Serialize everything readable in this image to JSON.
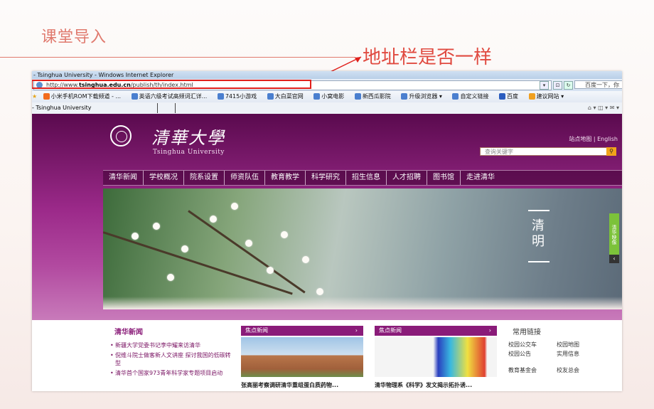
{
  "slide": {
    "title": "课堂导入",
    "callout": "地址栏是否一样",
    "colors": {
      "accent": "#e07a6e",
      "callout": "#e04a40",
      "highlight": "#e0201c"
    }
  },
  "browser": {
    "window_title": "- Tsinghua University - Windows Internet Explorer",
    "address_prefix": "http://www.",
    "address_host": "tsinghua.edu.cn",
    "address_path": "/publish/th/index.html",
    "search_box_text": "百度一下，你",
    "favorites": [
      {
        "label": "小米手机ROM下载频道 - ...",
        "icon": "mi-icon"
      },
      {
        "label": "英语六级考试高频词汇详...",
        "icon": "ie-icon"
      },
      {
        "label": "7415小游戏",
        "icon": "ie-icon"
      },
      {
        "label": "大白菜官网",
        "icon": "ie-icon"
      },
      {
        "label": "小窝电影",
        "icon": "ie-icon"
      },
      {
        "label": "新西瓜影院",
        "icon": "ie-icon"
      },
      {
        "label": "升级浏览器 ▾",
        "icon": "ie-icon"
      },
      {
        "label": "自定义链接",
        "icon": "ie-icon"
      },
      {
        "label": "百度",
        "icon": "baidu-icon"
      },
      {
        "label": "建议网站 ▾",
        "icon": "suggest-icon"
      }
    ],
    "tab_title": "- Tsinghua University"
  },
  "site": {
    "logo_cn": "清華大學",
    "logo_en": "Tsinghua University",
    "top_links": "站点地图 | English",
    "search_placeholder": "查询关键字",
    "nav": [
      "清华新闻",
      "学校概况",
      "院系设置",
      "师资队伍",
      "教育教学",
      "科学研究",
      "招生信息",
      "人才招聘",
      "图书馆",
      "走进清华"
    ],
    "banner_text": "清明",
    "side_tab": "清华映像",
    "news_title": "清华新闻",
    "news": [
      "新疆大学党委书记李中耀来访清华",
      "倪维斗院士做客新人文讲座 探讨我国的低碳转型",
      "清华首个国家973青年科学家专题项目启动"
    ],
    "focus1": {
      "head": "焦点新闻",
      "caption": "张高丽考察调研清华重组蛋白质药物..."
    },
    "focus2": {
      "head": "焦点新闻",
      "caption": "清华物理系《科学》发文揭示拓扑诱..."
    },
    "links_title": "常用链接",
    "links": [
      [
        "校园公交车",
        "校园地图"
      ],
      [
        "校园公告",
        "实用信息"
      ],
      [
        "教育基金会",
        "校友总会"
      ]
    ]
  }
}
